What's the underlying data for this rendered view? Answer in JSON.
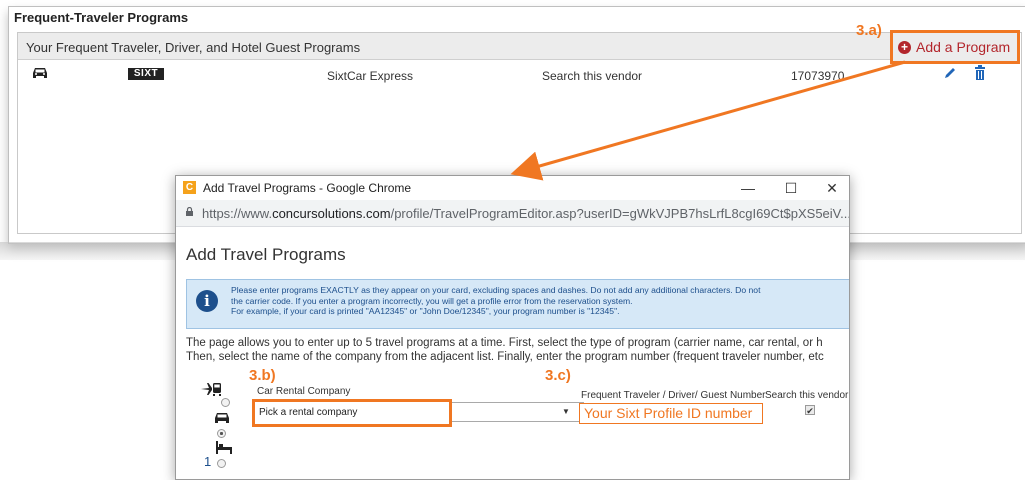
{
  "background": {
    "section_title": "Frequent-Traveler Programs",
    "subtitle": "Your Frequent Traveler, Driver, and Hotel Guest Programs",
    "add_button_label": "Add a Program",
    "annotation_3a": "3.a)",
    "row": {
      "logo_text": "SIXT",
      "program_name": "SixtCar Express",
      "search_flag": "Search this vendor",
      "number": "17073970"
    }
  },
  "popup": {
    "window_title": "Add Travel Programs - Google Chrome",
    "url_prefix": "https://www.",
    "url_host": "concursolutions.com",
    "url_path": "/profile/TravelProgramEditor.asp?userID=gWkVJPB7hsLrfL8cgI69Ct$pXS5eiV...",
    "heading": "Add Travel Programs",
    "info_line1": "Please enter programs EXACTLY as they appear on your card, excluding spaces and dashes. Do not add any additional characters. Do not",
    "info_line2": "the carrier code. If you enter a program incorrectly, you will get a profile error from the reservation system.",
    "info_line3": "For example, if your card is printed \"AA12345\" or \"John Doe/12345\", your program number is \"12345\".",
    "intro_line1": "The page allows you to enter up to 5 travel programs at a time. First, select the type of program (carrier name, car rental, or h",
    "intro_line2": "Then, select the name of the company from the adjacent list. Finally, enter the program number (frequent traveler number, etc",
    "annotation_3b": "3.b)",
    "annotation_3c": "3.c)",
    "col_company": "Car Rental Company",
    "col_number": "Frequent Traveler / Driver/ Guest Number",
    "col_search": "Search this vendor",
    "company_select_value": "Pick a rental company",
    "number_placeholder": "Your Sixt Profile ID number",
    "row_index": "1"
  },
  "colors": {
    "annotation": "#f07722",
    "accent_red": "#b3262c",
    "info_blue": "#1d4f8c"
  }
}
